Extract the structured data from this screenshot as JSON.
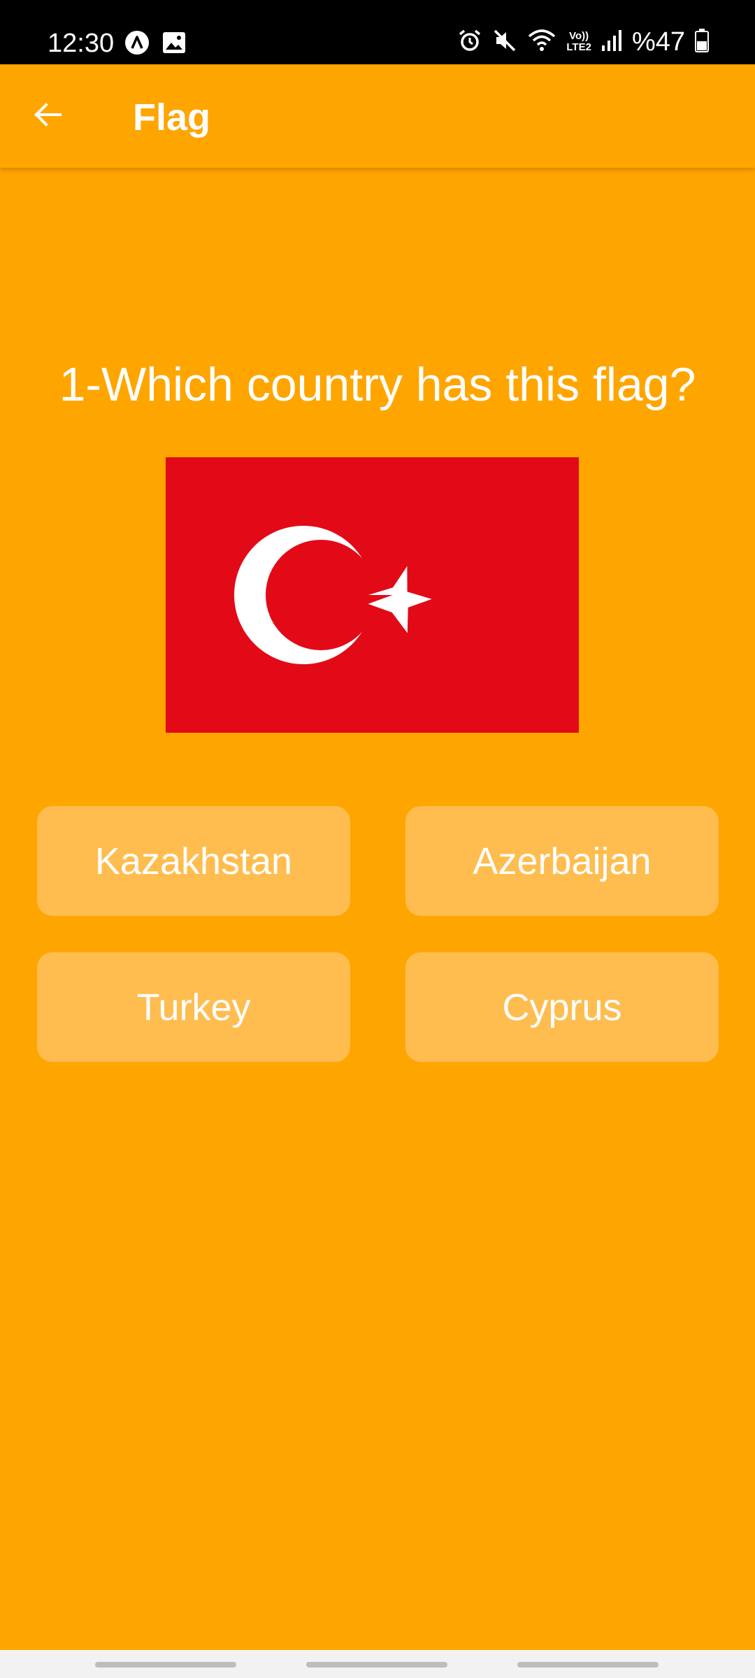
{
  "status_bar": {
    "time": "12:30",
    "battery": "%47",
    "left_icons": [
      "app-a-icon",
      "image-icon"
    ],
    "right_icons": [
      "alarm-icon",
      "mute-icon",
      "wifi-icon",
      "volte-lte2-icon",
      "signal-icon",
      "battery-icon"
    ],
    "volte_label_top": "Vo))",
    "volte_label_bottom": "LTE2"
  },
  "app_bar": {
    "title": "Flag",
    "back_icon": "arrow-back-icon"
  },
  "quiz": {
    "question": "1-Which country has this flag?",
    "flag_colors": {
      "field": "#E30A17",
      "emblem": "#FFFFFF"
    },
    "answers": [
      {
        "label": "Kazakhstan"
      },
      {
        "label": "Azerbaijan"
      },
      {
        "label": "Turkey"
      },
      {
        "label": "Cyprus"
      }
    ]
  },
  "colors": {
    "background": "#FFA500",
    "button": "#FFBD4F",
    "text": "#FFFFFF",
    "status_bar": "#000000"
  }
}
